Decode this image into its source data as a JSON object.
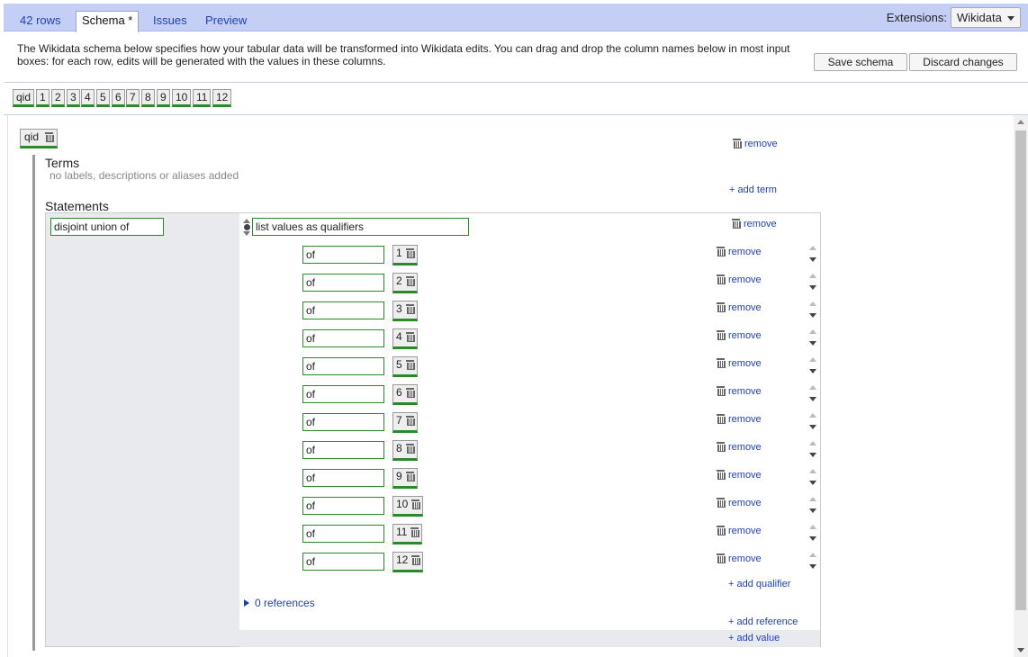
{
  "tabs": [
    {
      "label": "42 rows",
      "active": false
    },
    {
      "label": "Schema *",
      "active": true
    },
    {
      "label": "Issues",
      "active": false
    },
    {
      "label": "Preview",
      "active": false
    }
  ],
  "extensions": {
    "label": "Extensions:",
    "selected": "Wikidata"
  },
  "description": "The Wikidata schema below specifies how your tabular data will be transformed into Wikidata edits. You can drag and drop the column names below in most input boxes: for each row, edits will be generated with the values in these columns.",
  "buttons": {
    "save": "Save schema",
    "discard": "Discard changes"
  },
  "columns": [
    "qid",
    "1",
    "2",
    "3",
    "4",
    "5",
    "6",
    "7",
    "8",
    "9",
    "10",
    "11",
    "12"
  ],
  "item": {
    "subject": "qid",
    "remove": "remove",
    "terms_heading": "Terms",
    "terms_empty": "no labels, descriptions or aliases added",
    "add_term": "+ add term",
    "statements_heading": "Statements",
    "statement": {
      "property": "disjoint union of",
      "value": "list values as qualifiers",
      "remove": "remove",
      "qualifiers": [
        {
          "property": "of",
          "value": "1",
          "remove": "remove"
        },
        {
          "property": "of",
          "value": "2",
          "remove": "remove"
        },
        {
          "property": "of",
          "value": "3",
          "remove": "remove"
        },
        {
          "property": "of",
          "value": "4",
          "remove": "remove"
        },
        {
          "property": "of",
          "value": "5",
          "remove": "remove"
        },
        {
          "property": "of",
          "value": "6",
          "remove": "remove"
        },
        {
          "property": "of",
          "value": "7",
          "remove": "remove"
        },
        {
          "property": "of",
          "value": "8",
          "remove": "remove"
        },
        {
          "property": "of",
          "value": "9",
          "remove": "remove"
        },
        {
          "property": "of",
          "value": "10",
          "remove": "remove"
        },
        {
          "property": "of",
          "value": "11",
          "remove": "remove"
        },
        {
          "property": "of",
          "value": "12",
          "remove": "remove"
        }
      ],
      "add_qualifier": "+ add qualifier",
      "references": "0 references",
      "add_reference": "+ add reference",
      "add_value": "+ add value"
    }
  },
  "colors": {
    "accent": "#1f3fb5",
    "tabbar": "#c5cff5",
    "green_underline": "#2a8a2a"
  }
}
